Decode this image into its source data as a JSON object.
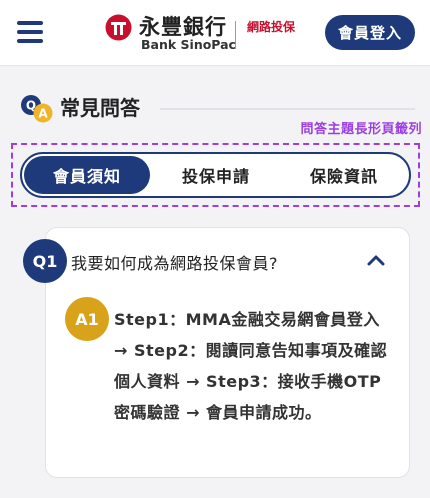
{
  "header": {
    "logo_name_zh": "永豐銀行",
    "logo_name_en": "Bank SinoPac",
    "logo_sub": "網路投保",
    "login_label": "會員登入"
  },
  "faq": {
    "title": "常見問答",
    "tab_annotation": "問答主題長形頁籤列",
    "tabs": [
      {
        "label": "會員須知",
        "active": true
      },
      {
        "label": "投保申請",
        "active": false
      },
      {
        "label": "保險資訊",
        "active": false
      }
    ],
    "item": {
      "q_badge": "Q1",
      "question": "我要如何成為網路投保會員?",
      "a_badge": "A1",
      "answer": "Step1：MMA金融交易網會員登入 → Step2：閱讀同意告知事項及確認個人資料 → Step3：接收手機OTP密碼驗證 → 會員申請成功。"
    }
  },
  "colors": {
    "brand_navy": "#1f3a7a",
    "brand_red": "#c8102e",
    "answer_gold": "#d9a21b",
    "annotation_purple": "#9b3fe0"
  }
}
